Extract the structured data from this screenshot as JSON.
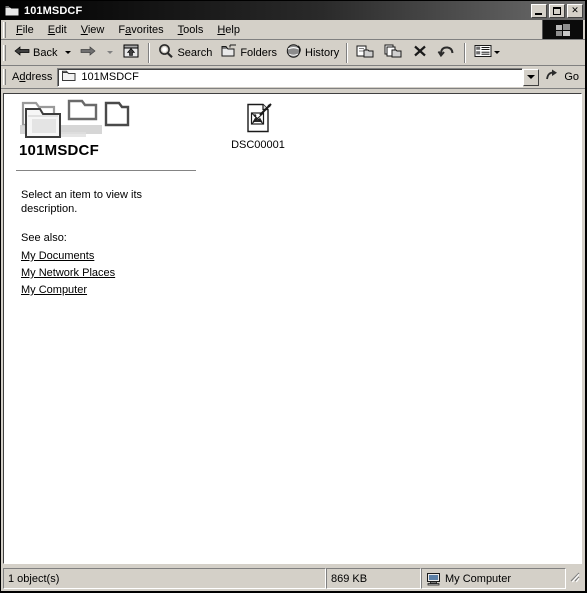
{
  "window": {
    "title": "101MSDCF",
    "title_icon": "folder-icon",
    "controls": {
      "minimize": "minimize-button",
      "maximize": "maximize-button",
      "close_label": "✕"
    }
  },
  "menubar": {
    "items": [
      {
        "label": "File",
        "accel": "F",
        "rest": "ile"
      },
      {
        "label": "Edit",
        "accel": "E",
        "rest": "dit"
      },
      {
        "label": "View",
        "accel": "V",
        "rest": "iew"
      },
      {
        "label": "Favorites",
        "pre": "F",
        "accel": "a",
        "rest": "vorites"
      },
      {
        "label": "Tools",
        "accel": "T",
        "rest": "ools"
      },
      {
        "label": "Help",
        "accel": "H",
        "rest": "elp"
      }
    ],
    "brand_icon": "windows-flag-icon"
  },
  "toolbar": {
    "back_label": "Back",
    "back_icon": "back-arrow-icon",
    "forward_label": "",
    "forward_icon": "forward-arrow-icon",
    "up_label": "",
    "up_icon": "up-folder-icon",
    "search_label": "Search",
    "search_icon": "search-icon",
    "folders_label": "Folders",
    "folders_icon": "folders-icon",
    "history_label": "History",
    "history_icon": "history-icon",
    "moveto_icon": "move-to-icon",
    "copyto_icon": "copy-to-icon",
    "delete_icon": "delete-x-icon",
    "undo_icon": "undo-icon",
    "views_icon": "views-icon"
  },
  "addressbar": {
    "label": "Address",
    "label_pre": "A",
    "label_accel": "d",
    "label_rest": "dress",
    "value": "101MSDCF",
    "placeholder": "",
    "folder_icon": "folder-icon",
    "dropdown_icon": "chevron-down-icon",
    "go_label": "Go",
    "go_icon": "go-arrow-icon"
  },
  "webview": {
    "folder_art_icon": "folder-watermark-icon",
    "title": "101MSDCF",
    "description": "Select an item to view its description.",
    "see_also_label": "See also:",
    "links": [
      {
        "label": "My Documents",
        "name": "link-my-documents"
      },
      {
        "label": "My Network Places",
        "name": "link-my-network-places"
      },
      {
        "label": "My Computer",
        "name": "link-my-computer"
      }
    ]
  },
  "files": [
    {
      "name": "DSC00001",
      "icon": "unknown-file-icon"
    }
  ],
  "statusbar": {
    "object_count": "1 object(s)",
    "size": "869 KB",
    "zone": "My Computer",
    "zone_icon": "computer-icon"
  },
  "colors": {
    "face": "#d4d0c8",
    "title_start": "#000000",
    "title_end": "#6e6e6e",
    "client": "#ffffff",
    "shadow": "#808080",
    "text": "#000000"
  }
}
